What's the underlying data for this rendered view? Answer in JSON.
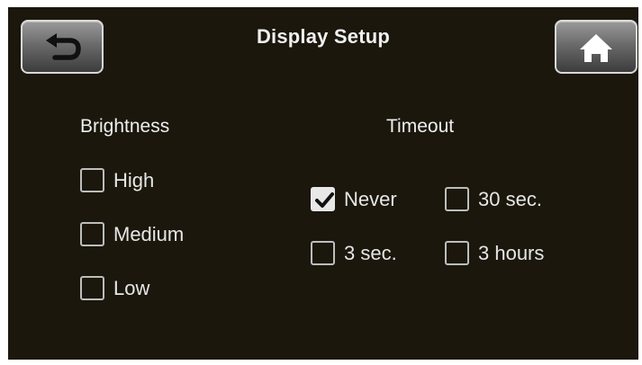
{
  "header": {
    "title": "Display Setup",
    "back_icon": "back-arrow-icon",
    "home_icon": "home-icon"
  },
  "brightness": {
    "heading": "Brightness",
    "options": [
      {
        "label": "High",
        "checked": false
      },
      {
        "label": "Medium",
        "checked": false
      },
      {
        "label": "Low",
        "checked": false
      }
    ]
  },
  "timeout": {
    "heading": "Timeout",
    "options": [
      {
        "label": "Never",
        "checked": true
      },
      {
        "label": "30 sec.",
        "checked": false
      },
      {
        "label": "3 sec.",
        "checked": false
      },
      {
        "label": "3 hours",
        "checked": false
      }
    ]
  },
  "colors": {
    "background": "#1b170c",
    "text": "#e6e6e6",
    "checkbox_border": "#bdbdbd"
  }
}
